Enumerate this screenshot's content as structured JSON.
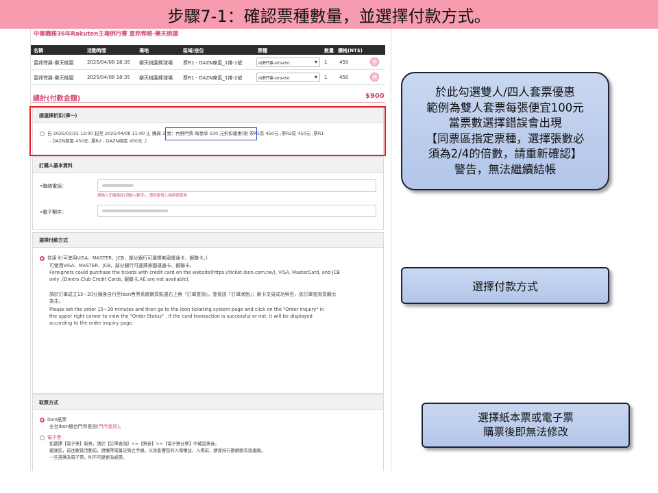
{
  "slide_title": "步驟7-1：確認票種數量，並選擇付款方式。",
  "screenshot": {
    "event_title": "中華職棒36年Rakuten主場例行賽  富邦悍將-樂天桃猿",
    "table": {
      "headers": [
        "名稱",
        "活動時間",
        "場地",
        "區域/座位",
        "票種",
        "數量",
        "價格(NT$)"
      ],
      "rows": [
        [
          "富邦悍將-樂天桃猿",
          "2025/04/08 18:35",
          "樂天桃園棒球場",
          "票R1 - DAZN席區_1排-1號",
          "內野門票-NT$450",
          "1",
          "450"
        ],
        [
          "富邦悍將-樂天桃猿",
          "2025/04/08 18:35",
          "樂天桃園棒球場",
          "票R1 - DAZN席區_1排-2號",
          "內野門票-NT$450",
          "1",
          "450"
        ]
      ]
    },
    "total_label": "總計(付款金額)",
    "total_value": "$900",
    "discount": {
      "heading": "請選擇折扣(擇一)",
      "option_line1_a": "自  2025/03/15 12:00  起至  2025/04/08 11:00  止",
      "option_highlight": "購買 2 張：內野門票 每張享 100 元",
      "option_line1_b": "折扣優惠(限 票R1區 450元 ,票R2區 450元 ,票R1",
      "option_line2": "- DAZN席區 450元 ,票R2 - DAZN席區 450元 ,)"
    },
    "buyer": {
      "heading": "訂購人基本資料",
      "phone_label": "•聯絡電話：",
      "phone_hint": "請輸入正確電話(須輸入數字)，僅供重發入場序號使用",
      "email_label": "•電子郵件："
    },
    "payment": {
      "heading": "選擇付款方式",
      "option": "信用卡(可使用VISA、MASTER、JCB，部分銀行可選擇美國運通卡、銀聯卡。)",
      "lines": [
        "可使用VISA、MASTER、JCB，部分銀行可選擇美國運通卡、銀聯卡。",
        "Foreigners could purchase the tickets with credit card on the website(https://ticket.ibon.com.tw/), VISA, MasterCard, and JCB",
        "only .(Diners Club Credit Cards, 銀聯卡,AE are not available).",
        "",
        "請於訂單成立15~20分鐘後自行至ibon售票系統網頁點選右上角『訂單查詢』，查看該『訂單狀態』；刷卡交易成功與否，依訂單查詢頁顯示",
        "為主。",
        "Please set the order 15~20 minutes and then go to the ibon ticketing system page and click on the  \"Order Inquiry\"  in",
        "the upper right corner to view the  \"Order Status\" . If the card transaction is successful or not, it will be displayed",
        "according to the order inquiry page."
      ]
    },
    "pickup": {
      "heading": "取票方式",
      "opt1": "ibon紙票",
      "opt1_desc_a": "全台ibon機台門市查詢",
      "opt1_desc_link": "(門市查詢)",
      "opt1_desc_b": "。",
      "opt2": "電子票",
      "opt2_lines": [
        "如選擇【電子票】取票，請於【訂單查詢】>>【票券】>>【電子票分票】中確認票券。",
        "建議您，前往觀賞活動前，請攜帶電量足夠之手機，以免影響您的入場權益，入場前，請保持行動網路有效連線。",
        "一旦選擇為電子票，則不可變更為紙票。"
      ]
    }
  },
  "callouts": {
    "c1": [
      "於此勾選雙人/四人套票優惠",
      "範例為雙人套票每張便宜100元",
      "當票數選擇錯誤會出現",
      "【同票區指定票種，選擇張數必",
      "須為2/4的倍數，請重新確認】",
      "警告，無法繼續結帳"
    ],
    "c2": "選擇付款方式",
    "c3": [
      "選擇紙本票或電子票",
      "購票後即無法修改"
    ]
  },
  "colors": {
    "title_bar": "#f79cae",
    "accent": "#d24a6c",
    "highlight_red": "#e0202a",
    "highlight_blue": "#3a4bd0",
    "callout_fill": "#b3c6ea"
  }
}
